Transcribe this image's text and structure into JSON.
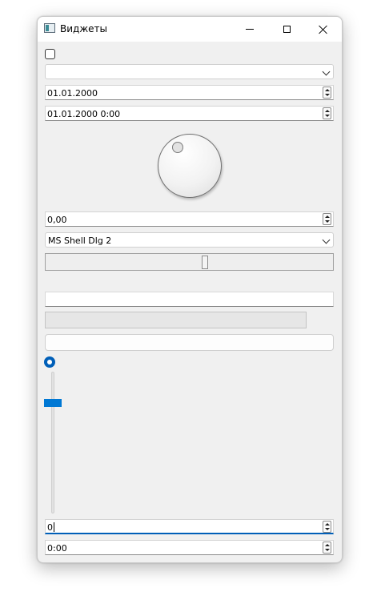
{
  "window": {
    "title": "Виджеты",
    "icon": "app-window-icon"
  },
  "checkbox": {
    "checked": false
  },
  "combo_empty": {
    "value": ""
  },
  "date_edit": {
    "value": "01.01.2000"
  },
  "datetime_edit": {
    "value": "01.01.2000 0:00"
  },
  "double_spin": {
    "value": "0,00"
  },
  "font_combo": {
    "value": "MS Shell Dlg 2"
  },
  "line_edit": {
    "value": ""
  },
  "push_button": {
    "label": ""
  },
  "radio": {
    "checked": true
  },
  "spin_box": {
    "value": "0"
  },
  "time_edit": {
    "value": "0:00"
  },
  "colors": {
    "accent": "#005fb8",
    "slider_handle": "#0078d4",
    "window_bg": "#f0f0f0"
  }
}
